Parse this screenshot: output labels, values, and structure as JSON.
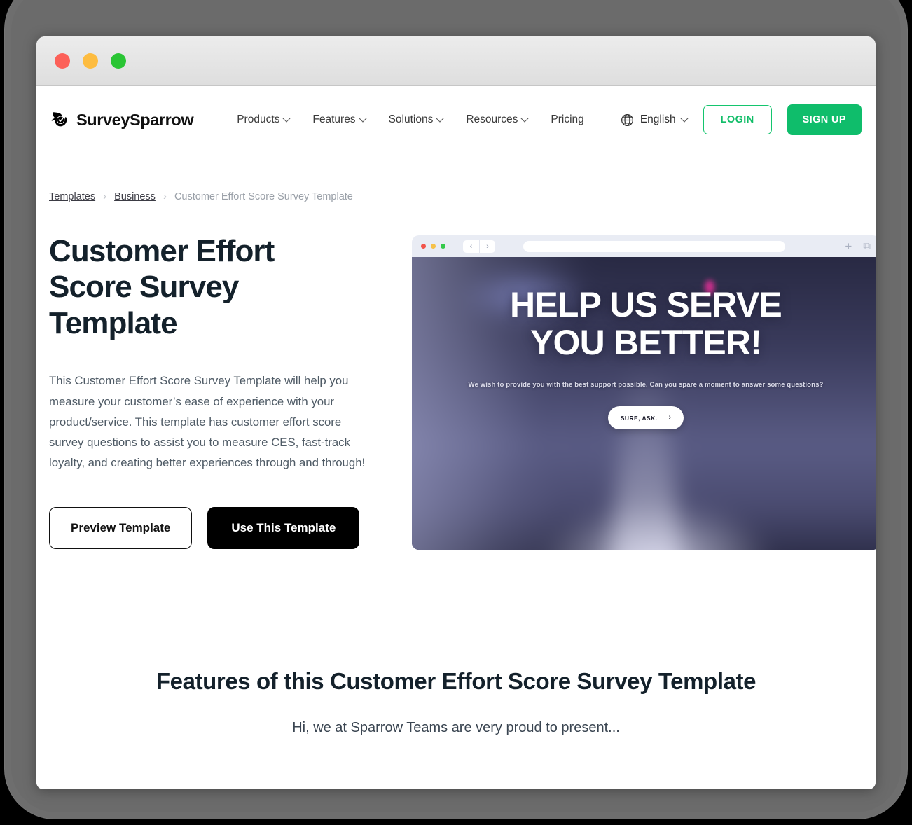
{
  "window": {
    "traffic_lights": [
      "close",
      "minimize",
      "maximize"
    ]
  },
  "navbar": {
    "brand": "SurveySparrow",
    "items": [
      {
        "label": "Products",
        "has_dropdown": true
      },
      {
        "label": "Features",
        "has_dropdown": true
      },
      {
        "label": "Solutions",
        "has_dropdown": true
      },
      {
        "label": "Resources",
        "has_dropdown": true
      },
      {
        "label": "Pricing",
        "has_dropdown": false
      }
    ],
    "language": "English",
    "login_label": "LOGIN",
    "signup_label": "SIGN UP",
    "accent_color": "#0fbd6b"
  },
  "breadcrumb": {
    "items": [
      "Templates",
      "Business"
    ],
    "current": "Customer Effort Score Survey Template",
    "separator": "›"
  },
  "hero": {
    "title": "Customer Effort Score Survey Template",
    "description": "This Customer Effort Score Survey Template will help you measure your customer’s ease of experience with your product/service. This template has customer effort score survey questions to assist you to measure CES, fast-track loyalty, and creating better experiences through and through!",
    "preview_button": "Preview Template",
    "use_button": "Use This Template"
  },
  "preview": {
    "chrome": {
      "back_icon": "‹",
      "forward_icon": "›",
      "url": "",
      "new_tab_icon": "+",
      "copy_icon": "⧉"
    },
    "survey": {
      "heading": "HELP US SERVE YOU BETTER!",
      "subtext": "We wish to provide you with the best support possible.  Can you spare a moment to answer some questions?",
      "cta_label": "SURE, ASK.",
      "cta_arrow": "›"
    }
  },
  "features": {
    "title": "Features of this Customer Effort Score Survey Template",
    "subtitle": "Hi, we at Sparrow Teams are very proud to present..."
  }
}
